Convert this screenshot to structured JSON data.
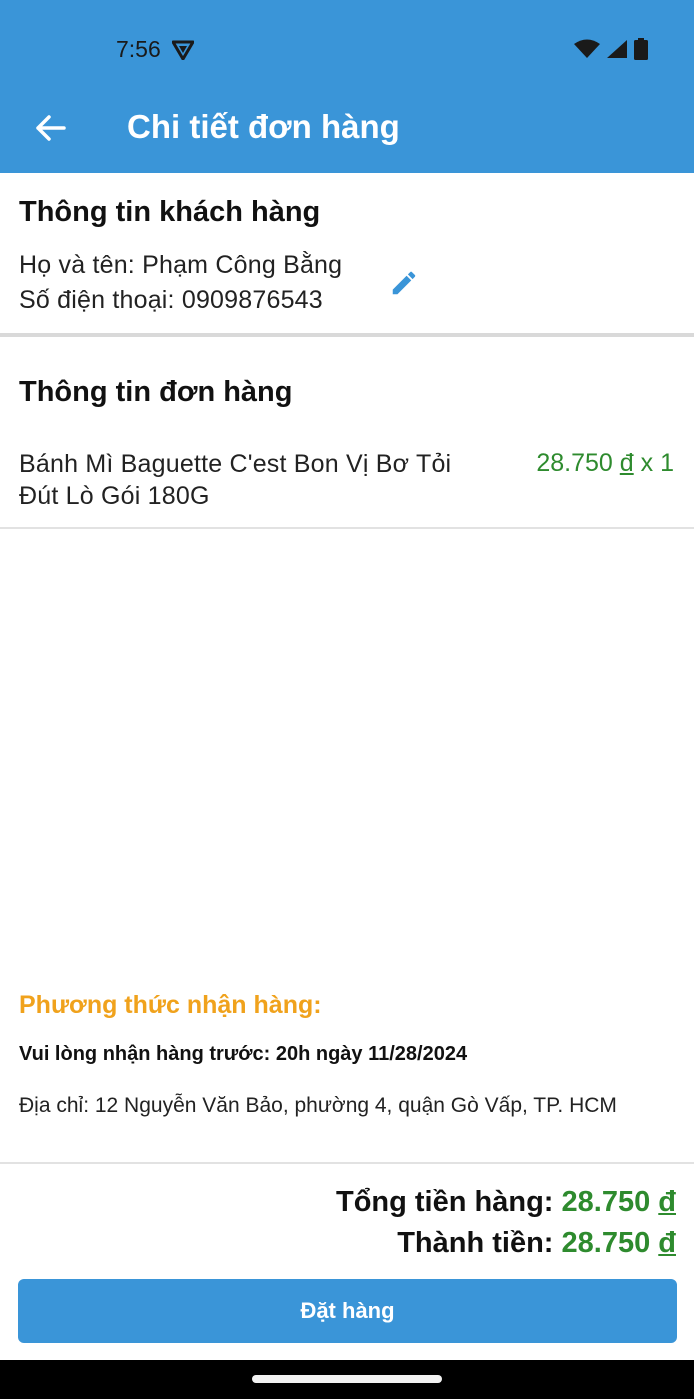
{
  "status_bar": {
    "time": "7:56",
    "icons": [
      "shield-icon",
      "wifi-icon",
      "cellular-icon",
      "battery-icon"
    ]
  },
  "app_bar": {
    "title": "Chi tiết đơn hàng",
    "back_icon": "arrow-left-icon"
  },
  "customer": {
    "section_title": "Thông tin khách hàng",
    "name_line": "Họ và tên: Phạm Công Bằng",
    "phone_line": "Số điện thoại: 0909876543",
    "edit_icon": "pencil-icon"
  },
  "order": {
    "section_title": "Thông tin đơn hàng",
    "items": [
      {
        "name_line1": "Bánh Mì Baguette C'est Bon Vị Bơ Tỏi",
        "name_line2": "Đút Lò Gói 180G",
        "price": "28.750",
        "currency": "đ",
        "quantity": "x 1"
      }
    ]
  },
  "delivery": {
    "title": "Phương thức nhận hàng:",
    "deadline": "Vui lòng nhận hàng trước: 20h ngày 11/28/2024",
    "address": "Địa chỉ: 12 Nguyễn Văn Bảo, phường 4, quận Gò Vấp, TP. HCM"
  },
  "totals": {
    "subtotal_label": "Tổng tiền hàng:",
    "subtotal_value": "28.750",
    "total_label": "Thành tiền:",
    "total_value": "28.750",
    "currency": "đ"
  },
  "actions": {
    "order_button": "Đặt hàng"
  },
  "colors": {
    "primary": "#3a95d8",
    "price_green": "#2e8b2e",
    "accent_orange": "#f0a21c"
  }
}
